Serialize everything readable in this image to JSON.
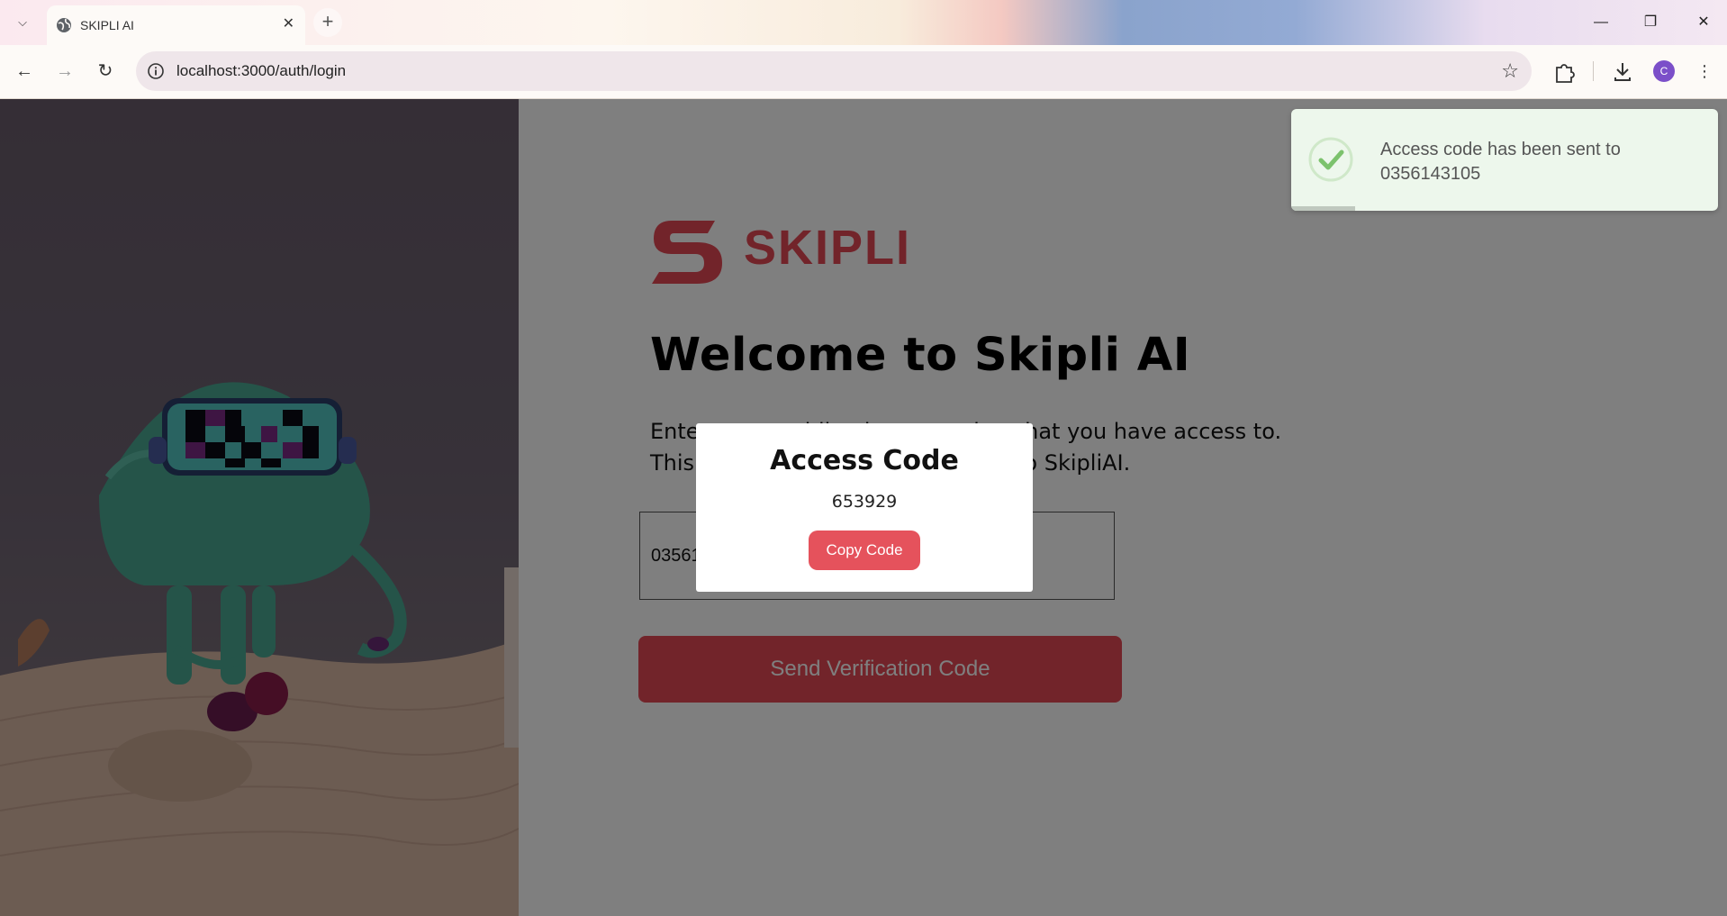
{
  "browser": {
    "tab_title": "SKIPLI AI",
    "url": "localhost:3000/auth/login",
    "profile_initial": "C"
  },
  "page": {
    "brand": "SKIPLI",
    "welcome_title": "Welcome to Skipli AI",
    "description_line1": "Enter your mobile phone number that you have access to.",
    "description_line2": "This number will be used to login to SkipliAI.",
    "phone_value": "0356143105",
    "send_button": "Send Verification Code"
  },
  "toast": {
    "message": "Access code has been sent to 0356143105",
    "progress": 0.15
  },
  "modal": {
    "title": "Access Code",
    "code": "653929",
    "copy_button": "Copy Code"
  },
  "colors": {
    "brand_red": "#e54854",
    "toast_bg": "#edf7ec",
    "toast_check": "#7cc26d"
  }
}
